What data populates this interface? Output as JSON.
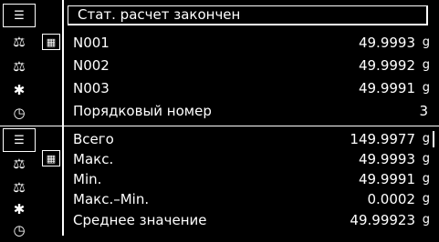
{
  "top_panel": {
    "title": "Стат. расчет закончен",
    "rows": [
      {
        "label": "N001",
        "value": "49.9993",
        "unit": "g"
      },
      {
        "label": "N002",
        "value": "49.9992",
        "unit": "g"
      },
      {
        "label": "N003",
        "value": "49.9991",
        "unit": "g"
      },
      {
        "label": "Порядковый номер",
        "value": "3",
        "unit": ""
      }
    ]
  },
  "bottom_panel": {
    "rows": [
      {
        "label": "Всего",
        "value": "149.9977",
        "unit": "g"
      },
      {
        "label": "Макс.",
        "value": "49.9993",
        "unit": "g"
      },
      {
        "label": "Min.",
        "value": "49.9991",
        "unit": "g"
      },
      {
        "label": "Макс.–Min.",
        "value": "0.0002",
        "unit": "g"
      },
      {
        "label": "Среднее значение",
        "value": "49.99923",
        "unit": "g"
      }
    ]
  },
  "icons": {
    "menu": "☰",
    "balance": "⚖",
    "weight_settings": "⚖",
    "gear": "✱",
    "clock": "◷",
    "calculator": "▦"
  }
}
